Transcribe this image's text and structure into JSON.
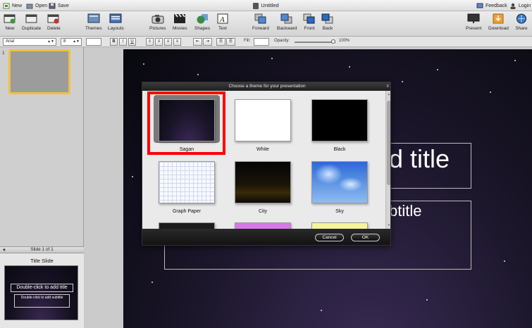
{
  "menubar": {
    "left": [
      {
        "label": "New",
        "icon": "new-doc-icon"
      },
      {
        "label": "Open",
        "icon": "folder-icon"
      },
      {
        "label": "Save",
        "icon": "save-icon"
      }
    ],
    "title": "Untitled",
    "right": [
      {
        "label": "Feedback",
        "icon": "feedback-icon"
      },
      {
        "label": "Login",
        "icon": "user-icon"
      }
    ]
  },
  "toolbar": {
    "new": "New",
    "duplicate": "Duplicate",
    "delete": "Delete",
    "themes": "Themes",
    "layouts": "Layouts",
    "pictures": "Pictures",
    "movies": "Movies",
    "shapes": "Shapes",
    "text": "Text",
    "text_icon_glyph": "A",
    "forward": "Forward",
    "backward": "Backward",
    "front": "Front",
    "back": "Back",
    "present": "Present",
    "download": "Download",
    "share": "Share"
  },
  "format": {
    "font": "Arial",
    "size": "8",
    "bold": "B",
    "italic": "I",
    "underline": "U",
    "fill_label": "Fill:",
    "opacity_label": "Opacity:",
    "opacity_value": "100%",
    "opacity": 1.0
  },
  "left": {
    "slide_number": "1",
    "slide_counter": "Slide 1 of 1",
    "layout_name": "Title Slide",
    "preview_title": "Double-click to add title",
    "preview_subtitle": "Double-click to add subtitle"
  },
  "slide": {
    "title_text": "d title",
    "subtitle_text": "btitle"
  },
  "dialog": {
    "title": "Choose a theme for your presentation",
    "close": "x",
    "themes": [
      {
        "name": "Sagan",
        "selected": true
      },
      {
        "name": "White",
        "selected": false
      },
      {
        "name": "Black",
        "selected": false
      },
      {
        "name": "Graph Paper",
        "selected": false
      },
      {
        "name": "City",
        "selected": false
      },
      {
        "name": "Sky",
        "selected": false
      }
    ],
    "cancel": "Cancel",
    "ok": "OK"
  },
  "colors": {
    "highlight": "#ff0000",
    "selection_border": "#f0c040"
  }
}
